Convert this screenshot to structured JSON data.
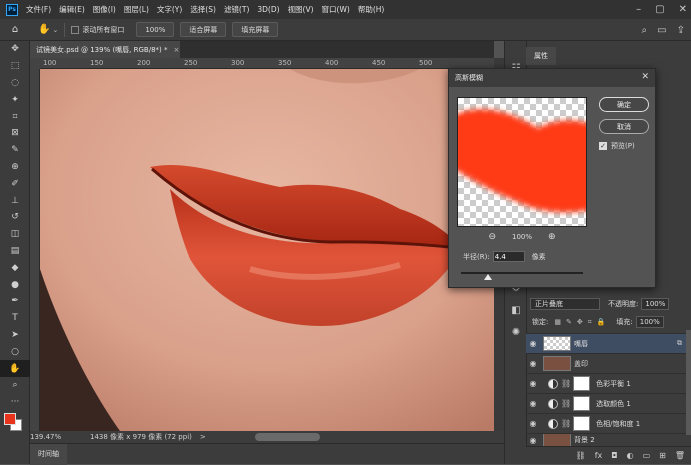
{
  "app": {
    "logo_text": "Ps"
  },
  "menu": [
    "文件(F)",
    "编辑(E)",
    "图像(I)",
    "图层(L)",
    "文字(Y)",
    "选择(S)",
    "滤镜(T)",
    "3D(D)",
    "视图(V)",
    "窗口(W)",
    "帮助(H)"
  ],
  "options": {
    "scroll_all_label": "滚动所有窗口",
    "zoom_value": "100%",
    "fit_screen_label": "适合屏幕",
    "fill_screen_label": "填充屏幕"
  },
  "document": {
    "tab_title": "试镜美女.psd @ 139% (嘴唇, RGB/8*) *"
  },
  "ruler": {
    "labels": [
      "100",
      "150",
      "200",
      "250",
      "300",
      "350",
      "400",
      "450",
      "500"
    ]
  },
  "status": {
    "zoom": "139.47%",
    "doc_size": "1438 像素 x 979 像素 (72 ppi)",
    "arrow": ">"
  },
  "timeline": {
    "label": "时间轴"
  },
  "panel": {
    "properties_tab": "属性"
  },
  "dialog": {
    "title": "高斯模糊",
    "ok_label": "确定",
    "cancel_label": "取消",
    "preview_label": "预览(P)",
    "zoom_value": "100%",
    "radius_label": "半径(R):",
    "radius_value": "4.4",
    "radius_unit": "像素",
    "slider_fraction": 0.22
  },
  "layers": {
    "blend_mode": "正片叠底",
    "opacity_label": "不透明度:",
    "opacity_value": "100%",
    "lock_label": "锁定:",
    "fill_label": "填充:",
    "fill_value": "100%",
    "items": [
      {
        "name": "嘴唇",
        "type": "pixel"
      },
      {
        "name": "盖印",
        "type": "pixel"
      },
      {
        "name": "色彩平衡 1",
        "type": "adjustment"
      },
      {
        "name": "选取颜色 1",
        "type": "adjustment"
      },
      {
        "name": "色相/饱和度 1",
        "type": "adjustment"
      },
      {
        "name": "背景 2",
        "type": "pixel"
      }
    ]
  },
  "colors": {
    "foreground": "#e8341c",
    "background": "#ffffff",
    "accent": "#31a8ff",
    "lip_fill": "#ff3a12"
  }
}
